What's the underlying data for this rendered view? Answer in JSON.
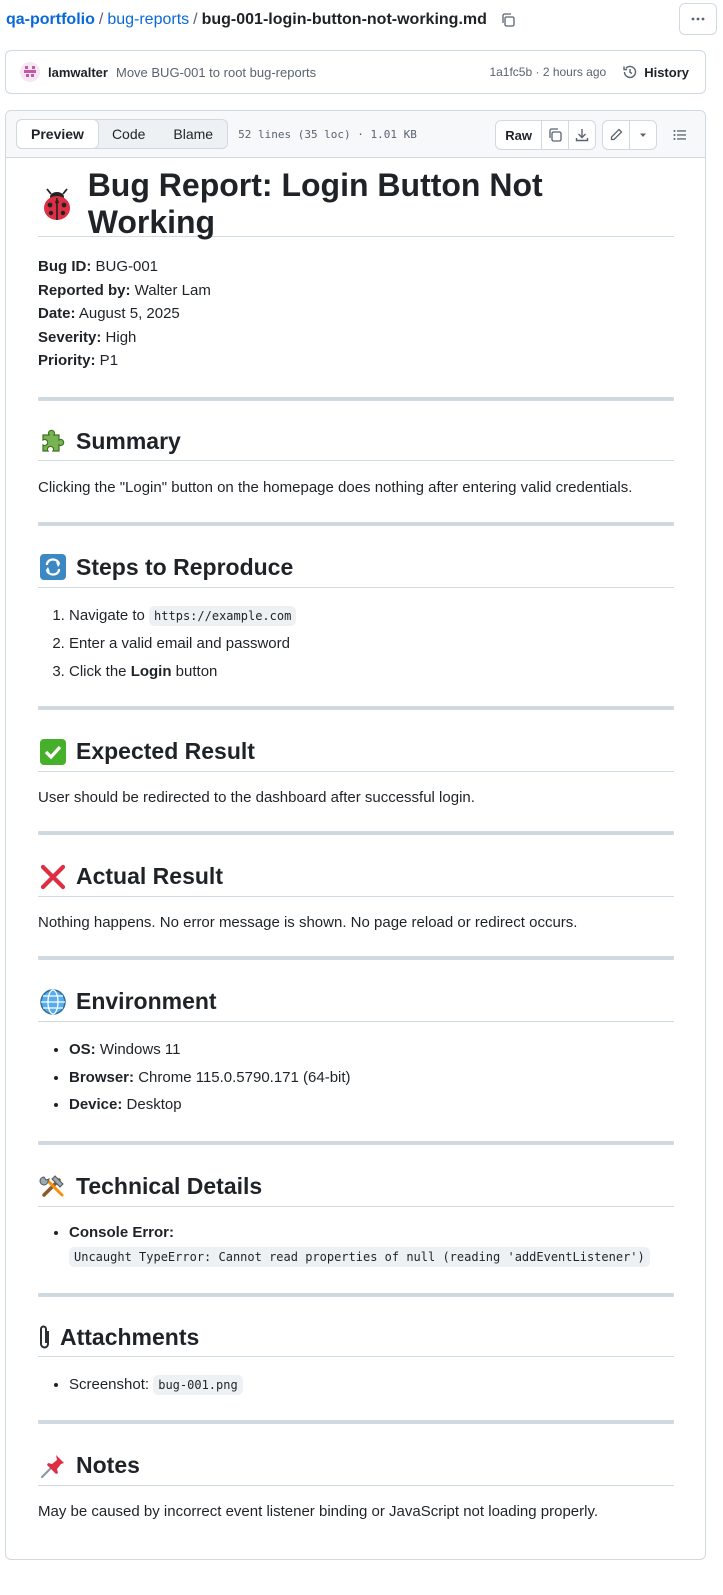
{
  "breadcrumb": {
    "repo": "qa-portfolio",
    "sep1": "/",
    "dir": "bug-reports",
    "sep2": "/",
    "file": "bug-001-login-button-not-working.md"
  },
  "commit": {
    "author": "lamwalter",
    "message": "Move BUG-001 to root bug-reports",
    "meta": "1a1fc5b · 2 hours ago",
    "history_label": "History"
  },
  "viewer": {
    "tabs": [
      "Preview",
      "Code",
      "Blame"
    ],
    "file_info": "52 lines (35 loc) · 1.01 KB",
    "raw_label": "Raw"
  },
  "doc": {
    "title": "Bug Report: Login Button Not Working",
    "meta": [
      {
        "key": "Bug ID:",
        "value": " BUG-001"
      },
      {
        "key": "Reported by:",
        "value": " Walter Lam"
      },
      {
        "key": "Date:",
        "value": " August 5, 2025"
      },
      {
        "key": "Severity:",
        "value": " High"
      },
      {
        "key": "Priority:",
        "value": " P1"
      }
    ],
    "summary": {
      "heading": "Summary",
      "text": "Clicking the \"Login\" button on the homepage does nothing after entering valid credentials."
    },
    "steps": {
      "heading": "Steps to Reproduce",
      "s1_pre": "Navigate to ",
      "s1_code": "https://example.com",
      "s2": "Enter a valid email and password",
      "s3_pre": "Click the ",
      "s3_bold": "Login",
      "s3_post": " button"
    },
    "expected": {
      "heading": "Expected Result",
      "text": "User should be redirected to the dashboard after successful login."
    },
    "actual": {
      "heading": "Actual Result",
      "text": "Nothing happens. No error message is shown. No page reload or redirect occurs."
    },
    "environment": {
      "heading": "Environment",
      "items": [
        {
          "key": "OS:",
          "value": " Windows 11"
        },
        {
          "key": "Browser:",
          "value": " Chrome 115.0.5790.171 (64-bit)"
        },
        {
          "key": "Device:",
          "value": " Desktop"
        }
      ]
    },
    "technical": {
      "heading": "Technical Details",
      "label": "Console Error:",
      "code": "Uncaught TypeError: Cannot read properties of null (reading 'addEventListener')"
    },
    "attachments": {
      "heading": "Attachments",
      "pre": "Screenshot: ",
      "code": "bug-001.png"
    },
    "notes": {
      "heading": "Notes",
      "text": "May be caused by incorrect event listener binding or JavaScript not loading properly."
    }
  },
  "colors": {
    "link": "#0969da",
    "border": "#d1d9e0",
    "muted": "#59636e",
    "text": "#1f2328"
  }
}
